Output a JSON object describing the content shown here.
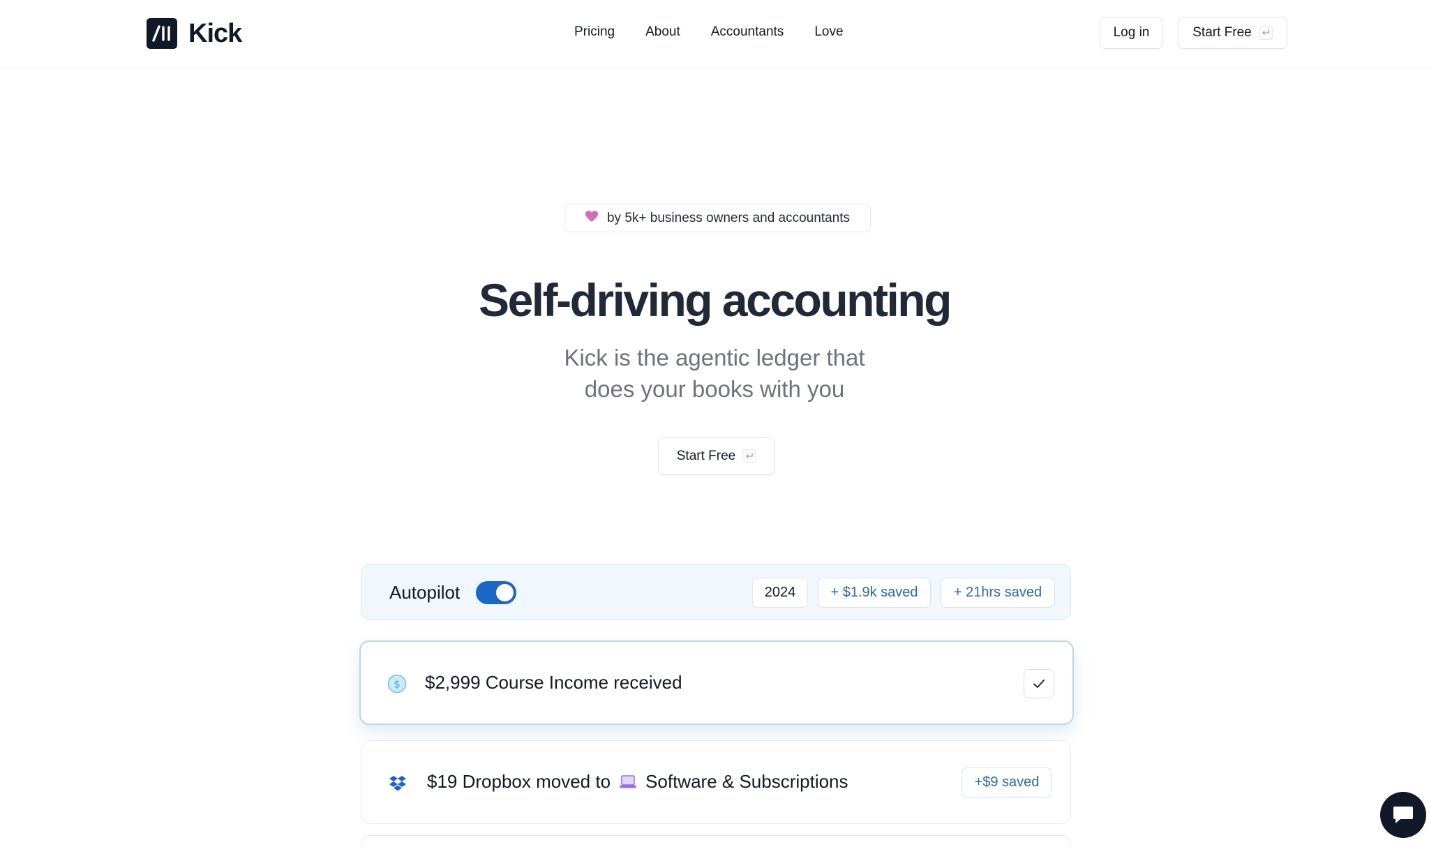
{
  "header": {
    "brand": "Kick",
    "nav": [
      "Pricing",
      "About",
      "Accountants",
      "Love"
    ],
    "login_label": "Log in",
    "start_label": "Start Free"
  },
  "hero": {
    "badge_text": "by 5k+ business owners and accountants",
    "title": "Self-driving accounting",
    "subtitle_line1": "Kick is the agentic ledger that",
    "subtitle_line2": "does your books with you",
    "cta_label": "Start Free"
  },
  "autopilot": {
    "label": "Autopilot",
    "enabled": true,
    "year": "2024",
    "money_saved": "+ $1.9k saved",
    "time_saved": "+ 21hrs saved"
  },
  "feed": [
    {
      "text": "$2,999 Course Income received",
      "icon": "dollar-coin-icon",
      "status": "check-icon"
    },
    {
      "text_before": "$19 Dropbox moved to",
      "category": "Software & Subscriptions",
      "icon": "dropbox-icon",
      "category_icon": "laptop-icon",
      "saved": "+$9 saved"
    }
  ],
  "colors": {
    "brand_dark": "#111827",
    "toggle_blue": "#1a67c7",
    "saved_blue": "#2a6aa8",
    "autopilot_bg": "#f0f8fd",
    "heart_pink": "#d36fb0"
  }
}
